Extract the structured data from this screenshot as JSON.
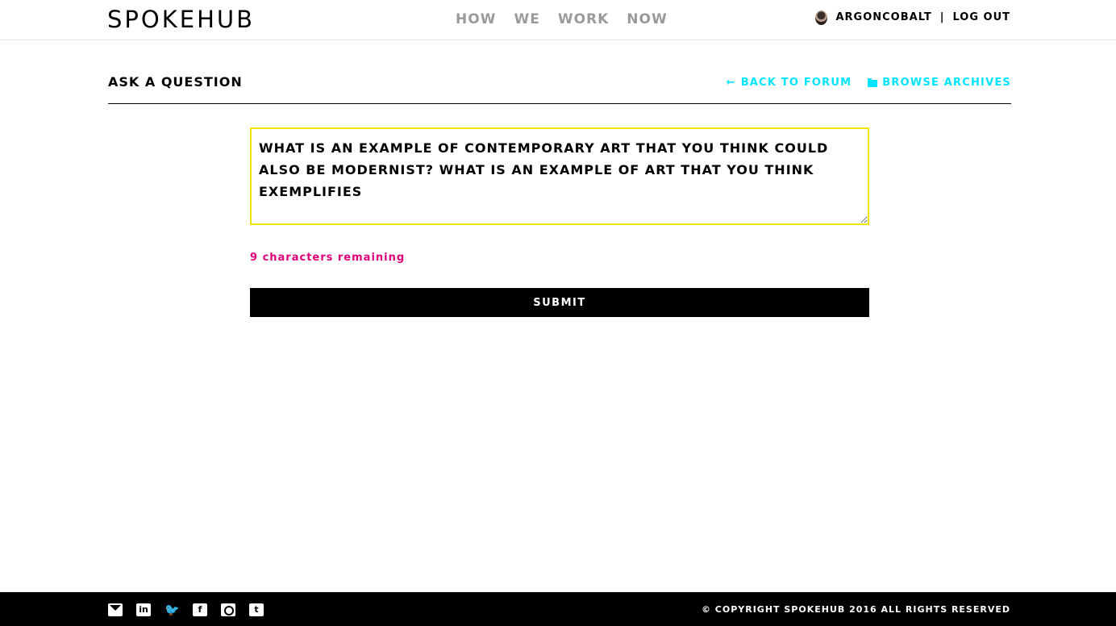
{
  "header": {
    "logo": "SPOKEHUB",
    "nav": [
      "HOW",
      "WE",
      "WORK",
      "NOW"
    ],
    "username": "ARGONCOBALT",
    "separator": "|",
    "logout": "LOG OUT"
  },
  "page": {
    "title": "ASK A QUESTION",
    "back_link": "BACK TO FORUM",
    "back_icon": "←",
    "archives_link": "BROWSE ARCHIVES"
  },
  "form": {
    "question_value": "WHAT IS AN EXAMPLE OF CONTEMPORARY ART THAT YOU THINK COULD ALSO BE MODERNIST? WHAT IS AN EXAMPLE OF ART THAT YOU THINK EXEMPLIFIES",
    "remaining": "9 characters remaining",
    "submit": "SUBMIT"
  },
  "footer": {
    "social_icons": [
      "mail-icon",
      "linkedin-icon",
      "twitter-icon",
      "facebook-icon",
      "instagram-icon",
      "tumblr-icon"
    ],
    "linkedin_glyph": "in",
    "twitter_glyph": "🐦",
    "facebook_glyph": "f",
    "tumblr_glyph": "t",
    "copyright": "© COPYRIGHT SPOKEHUB 2016 ALL RIGHTS RESERVED"
  },
  "colors": {
    "accent_link": "#00e5ff",
    "remaining_text": "#e0007a",
    "focus_border": "#f2e600",
    "nav_inactive": "#9a9a9a"
  }
}
